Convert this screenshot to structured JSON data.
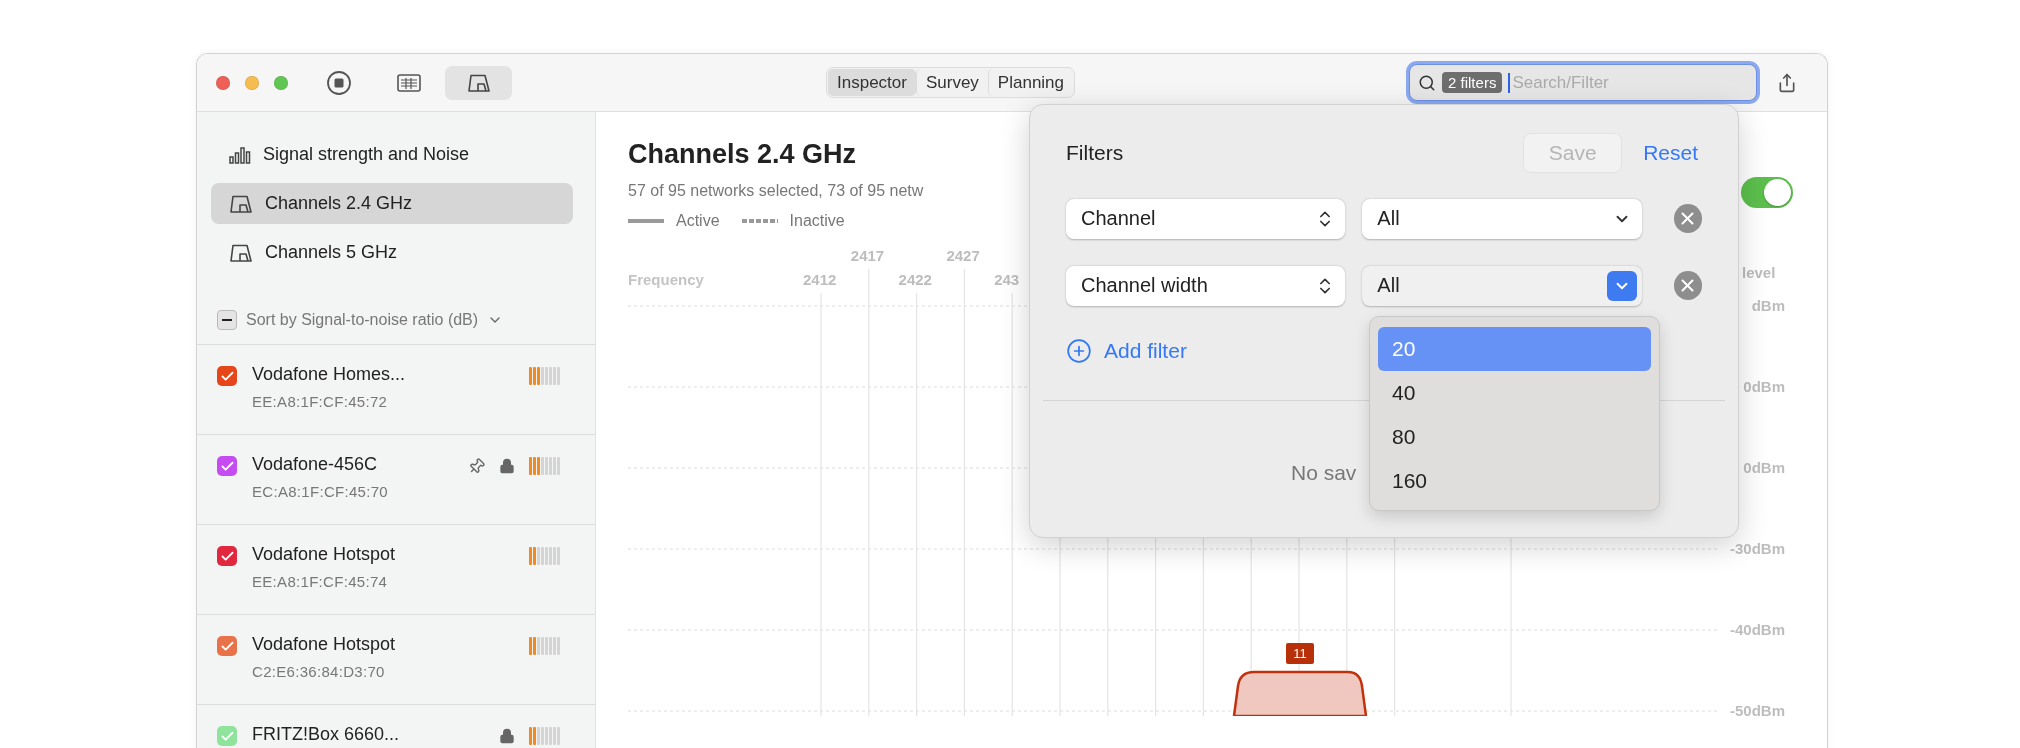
{
  "toolbar": {
    "view_buttons": [
      {
        "kind": "stop",
        "selected": false
      },
      {
        "kind": "table",
        "selected": false
      },
      {
        "kind": "channels",
        "selected": true
      }
    ],
    "segments": [
      {
        "label": "Inspector",
        "selected": true
      },
      {
        "label": "Survey",
        "selected": false
      },
      {
        "label": "Planning",
        "selected": false
      }
    ],
    "search": {
      "token": "2 filters",
      "placeholder": "Search/Filter",
      "focused": true
    }
  },
  "sidebar": {
    "items": [
      {
        "label": "Signal strength and Noise",
        "selected": false
      },
      {
        "label": "Channels 2.4 GHz",
        "selected": true
      },
      {
        "label": "Channels 5 GHz",
        "selected": false
      }
    ],
    "sort": {
      "label": "Sort by Signal-to-noise ratio (dB)",
      "mixed": true
    },
    "networks": [
      {
        "name": "Vodafone Homes...",
        "mac": "EE:A8:1F:CF:45:72",
        "color": "#e5461a",
        "checked": true,
        "pinned": false,
        "locked": false,
        "level": 0.375
      },
      {
        "name": "Vodafone-456C",
        "mac": "EC:A8:1F:CF:45:70",
        "color": "#c54cf0",
        "checked": true,
        "pinned": true,
        "locked": true,
        "level": 0.375
      },
      {
        "name": "Vodafone Hotspot",
        "mac": "EE:A8:1F:CF:45:74",
        "color": "#e0283f",
        "checked": true,
        "pinned": false,
        "locked": false,
        "level": 0.25
      },
      {
        "name": "Vodafone Hotspot",
        "mac": "C2:E6:36:84:D3:70",
        "color": "#e8734a",
        "checked": true,
        "pinned": false,
        "locked": false,
        "level": 0.25
      },
      {
        "name": "FRITZ!Box 6660...",
        "color": "#8fe39c",
        "checked": true,
        "pinned": false,
        "locked": true,
        "level": 0.25
      }
    ]
  },
  "content": {
    "title": "Channels 2.4 GHz",
    "subtitle": "57 of 95 networks selected, 73 of 95 netw",
    "legend": [
      {
        "label": "Active",
        "kind": "solid"
      },
      {
        "label": "Inactive",
        "kind": "dashed"
      }
    ],
    "toggle": {
      "on": true
    },
    "level_label": "level",
    "chart": {
      "axis_title": "Frequency",
      "frequency_ticks": [
        "2412",
        "2417",
        "2422",
        "2427",
        "243"
      ],
      "dbm_labels": [
        "dBm",
        "0dBm",
        "0dBm",
        "-30dBm",
        "-40dBm",
        "-50dBm"
      ],
      "channel_badge": "11"
    }
  },
  "popover": {
    "title": "Filters",
    "save": {
      "label": "Save",
      "disabled": true
    },
    "reset": "Reset",
    "filters": [
      {
        "field": "Channel",
        "value": "All",
        "open": false
      },
      {
        "field": "Channel width",
        "value": "All",
        "open": true
      }
    ],
    "add_filter": "Add filter",
    "empty_text": "No sav",
    "dropdown": {
      "options": [
        {
          "label": "20",
          "selected": true
        },
        {
          "label": "40",
          "selected": false
        },
        {
          "label": "80",
          "selected": false
        },
        {
          "label": "160",
          "selected": false
        }
      ]
    }
  }
}
